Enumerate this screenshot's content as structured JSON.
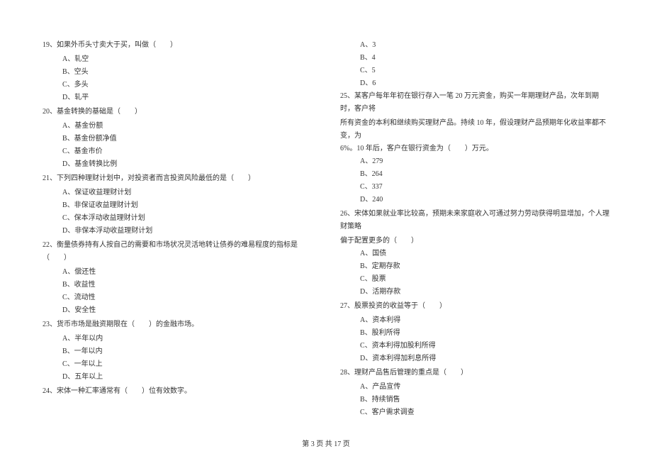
{
  "left_column": {
    "questions": [
      {
        "num": "19、",
        "text": "如果外币头寸卖大于买，叫做（　　）",
        "options": [
          "A、轧空",
          "B、空头",
          "C、多头",
          "D、轧平"
        ]
      },
      {
        "num": "20、",
        "text": "基金转换的基础是（　　）",
        "options": [
          "A、基金份额",
          "B、基金份额净值",
          "C、基金市价",
          "D、基金转换比例"
        ]
      },
      {
        "num": "21、",
        "text": "下列四种理财计划中，对投资者而言投资风险最低的是（　　）",
        "options": [
          "A、保证收益理财计划",
          "B、非保证收益理财计划",
          "C、保本浮动收益理财计划",
          "D、非保本浮动收益理财计划"
        ]
      },
      {
        "num": "22、",
        "text": "衡量债券持有人按自己的需要和市场状况灵活地转让债券的难易程度的指标是（　　）",
        "options": [
          "A、偿还性",
          "B、收益性",
          "C、流动性",
          "D、安全性"
        ]
      },
      {
        "num": "23、",
        "text": "货币市场是融资期限在（　　）的金融市场。",
        "options": [
          "A、半年以内",
          "B、一年以内",
          "C、一年以上",
          "D、五年以上"
        ]
      },
      {
        "num": "24、",
        "text": "宋体一种汇率通常有（　　）位有效数字。",
        "options": []
      }
    ]
  },
  "right_column": {
    "opening_options": [
      "A、3",
      "B、4",
      "C、5",
      "D、6"
    ],
    "questions": [
      {
        "num": "25、",
        "lines": [
          "某客户每年年初在银行存入一笔 20 万元资金，购买一年期理财产品，次年到期时，客户将",
          "所有资金的本利和继续购买理财产品。持续 10 年，假设理财产品预期年化收益率都不变，为",
          "6%。10 年后，客户在银行资金为（　　）万元。"
        ],
        "options": [
          "A、279",
          "B、264",
          "C、337",
          "D、240"
        ]
      },
      {
        "num": "26、",
        "lines": [
          "宋体如果就业率比较高，预期未来家庭收入可通过努力劳动获得明显增加，个人理财策略",
          "偏于配置更多的（　　）"
        ],
        "options": [
          "A、国债",
          "B、定期存款",
          "C、股票",
          "D、活期存款"
        ]
      },
      {
        "num": "27、",
        "lines": [
          "股票投资的收益等于（　　）"
        ],
        "options": [
          "A、资本利得",
          "B、股利所得",
          "C、资本利得加股利所得",
          "D、资本利得加利息所得"
        ]
      },
      {
        "num": "28、",
        "lines": [
          "理财产品售后管理的重点是（　　）"
        ],
        "options": [
          "A、产品宣传",
          "B、持续销售",
          "C、客户需求调查"
        ]
      }
    ]
  },
  "footer": "第 3 页 共 17 页"
}
